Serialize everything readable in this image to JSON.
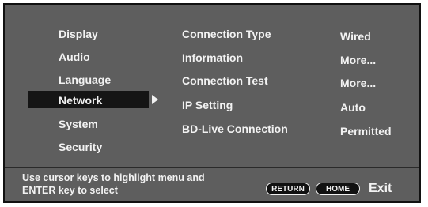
{
  "menu": {
    "items": [
      "Display",
      "Audio",
      "Language",
      "Network",
      "System",
      "Security"
    ],
    "selected": "Network"
  },
  "settings": [
    {
      "label": "Connection Type",
      "value": "Wired"
    },
    {
      "label": "Information",
      "value": "More..."
    },
    {
      "label": "Connection Test",
      "value": "More..."
    },
    {
      "label": "IP Setting",
      "value": "Auto"
    },
    {
      "label": "BD-Live Connection",
      "value": "Permitted"
    }
  ],
  "footer": {
    "hint_line1": "Use cursor keys to highlight menu and",
    "hint_line2": "ENTER key to select",
    "return_label": "RETURN",
    "home_label": "HOME",
    "exit_label": "Exit"
  },
  "colors": {
    "panel": "#5e5e5e",
    "selected": "#151515",
    "text": "#f2f2f2"
  }
}
